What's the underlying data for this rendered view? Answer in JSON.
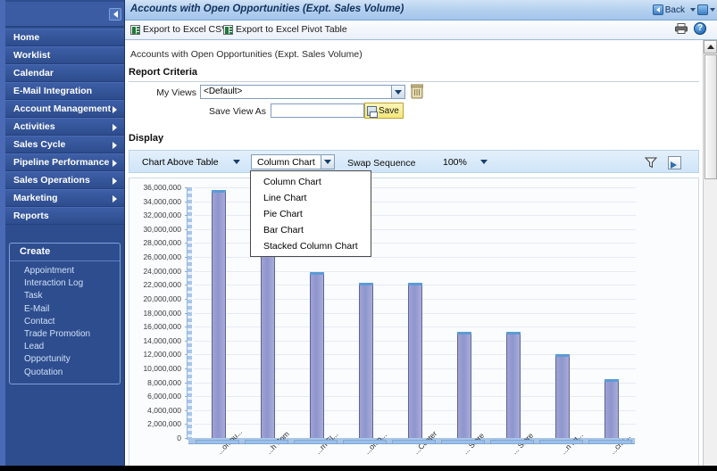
{
  "window": {
    "title": "Accounts with Open Opportunities (Expt. Sales Volume)",
    "back_label": "Back",
    "print_icon": "printer-icon",
    "help_icon": "help-icon"
  },
  "sidebar": {
    "collapse_icon": "collapse-left-icon",
    "items": [
      {
        "label": "Home",
        "has_arrow": false
      },
      {
        "label": "Worklist",
        "has_arrow": false
      },
      {
        "label": "Calendar",
        "has_arrow": false
      },
      {
        "label": "E-Mail Integration",
        "has_arrow": false
      },
      {
        "label": "Account Management",
        "has_arrow": true
      },
      {
        "label": "Activities",
        "has_arrow": true
      },
      {
        "label": "Sales Cycle",
        "has_arrow": true
      },
      {
        "label": "Pipeline Performance",
        "has_arrow": true
      },
      {
        "label": "Sales Operations",
        "has_arrow": true
      },
      {
        "label": "Marketing",
        "has_arrow": true
      },
      {
        "label": "Reports",
        "has_arrow": false
      }
    ],
    "create": {
      "title": "Create",
      "links": [
        "Appointment",
        "Interaction Log",
        "Task",
        "E-Mail",
        "Contact",
        "Trade Promotion",
        "Lead",
        "Opportunity",
        "Quotation"
      ]
    }
  },
  "toolbar": {
    "export_csv": "Export to Excel CSV",
    "export_pivot": "Export to Excel Pivot Table",
    "export_icon": "excel-icon"
  },
  "report": {
    "subtitle": "Accounts with Open Opportunities (Expt. Sales Volume)",
    "criteria_title": "Report Criteria",
    "my_views_label": "My Views",
    "my_views_value": "<Default>",
    "delete_view_icon": "trash-icon",
    "save_view_as_label": "Save View As",
    "save_view_as_value": "",
    "save_button": "Save",
    "save_icon": "disk-icon",
    "display_title": "Display"
  },
  "display_toolbar": {
    "layout_value": "Chart Above Table",
    "chart_type_value": "Column Chart",
    "swap_sequence": "Swap Sequence",
    "zoom_value": "100%",
    "filter_icon": "funnel-icon",
    "image_export_icon": "image-export-icon"
  },
  "chart_type_menu": {
    "open": true,
    "options": [
      "Column Chart",
      "Line Chart",
      "Pie Chart",
      "Bar Chart",
      "Stacked Column Chart"
    ]
  },
  "chart_data": {
    "type": "bar",
    "title": "",
    "xlabel": "",
    "ylabel": "",
    "ylim": [
      0,
      36000000
    ],
    "grid": true,
    "legend": "none",
    "ytick_labels": [
      "36,000,000",
      "34,000,000",
      "32,000,000",
      "30,000,000",
      "28,000,000",
      "26,000,000",
      "24,000,000",
      "22,000,000",
      "20,000,000",
      "18,000,000",
      "16,000,000",
      "14,000,000",
      "12,000,000",
      "10,000,000",
      "8,000,000",
      "6,000,000",
      "4,000,000",
      "2,000,000",
      "0"
    ],
    "ytick_values": [
      36000000,
      34000000,
      32000000,
      30000000,
      28000000,
      26000000,
      24000000,
      22000000,
      20000000,
      18000000,
      16000000,
      14000000,
      12000000,
      10000000,
      8000000,
      6000000,
      4000000,
      2000000,
      0
    ],
    "categories": [
      "...ompu...",
      "...h Com",
      "...rn El...",
      "...omp...",
      "...Center",
      "... Store",
      "... Store",
      "...n Int...",
      "...chn..."
    ],
    "values": [
      35400000,
      27600000,
      23600000,
      22000000,
      22000000,
      15000000,
      15000000,
      11800000,
      8200000
    ],
    "series": [
      {
        "name": "Expt. Sales Volume",
        "values": [
          35400000,
          27600000,
          23600000,
          22000000,
          22000000,
          15000000,
          15000000,
          11800000,
          8200000
        ]
      }
    ]
  },
  "scrollbar": {
    "up_arrow": "scroll-up-icon"
  }
}
